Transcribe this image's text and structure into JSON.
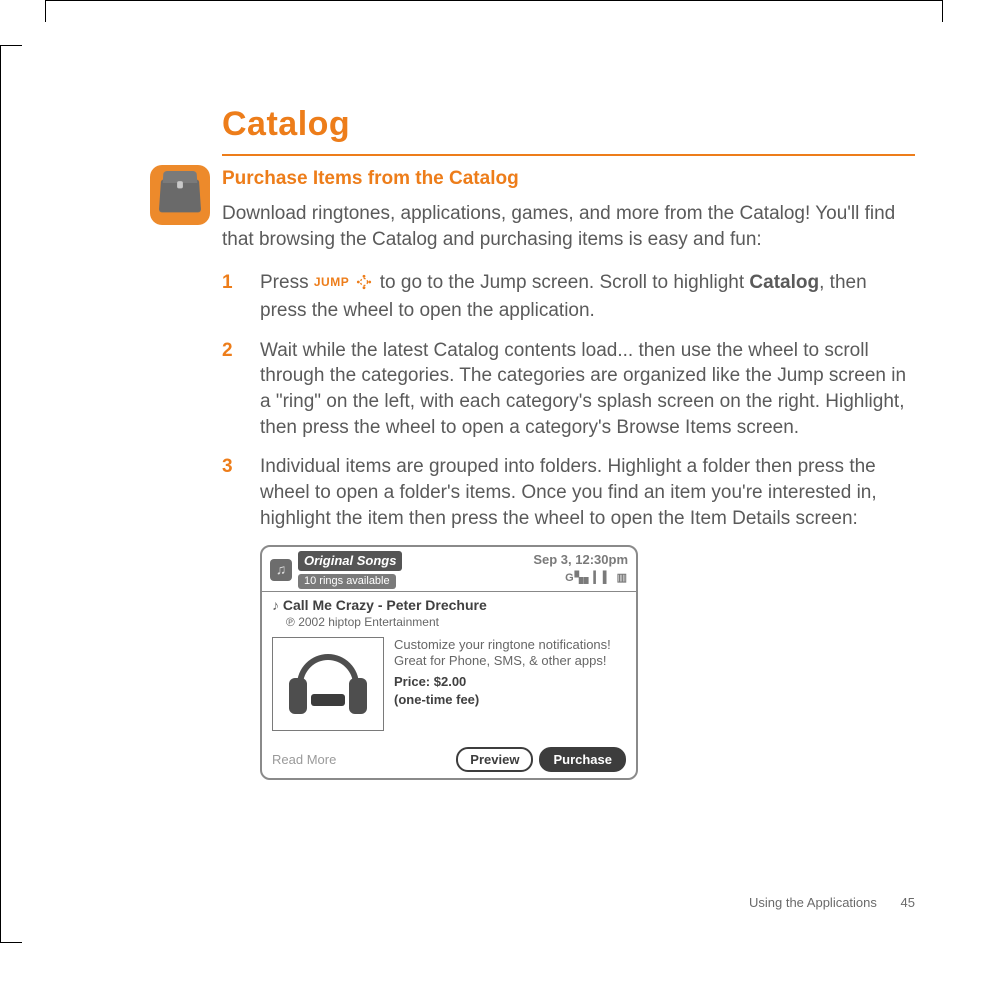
{
  "header": {
    "title": "Catalog"
  },
  "section": {
    "subhead": "Purchase Items from the Catalog",
    "intro": "Download ringtones, applications, games, and more from the Catalog! You'll find that browsing the Catalog and purchasing items is easy and fun:"
  },
  "jump": {
    "label": "JUMP"
  },
  "steps": {
    "s1": {
      "num": "1",
      "pre": "Press ",
      "post_a": "to go to the Jump screen. Scroll to highlight ",
      "bold": "Catalog",
      "post_b": ", then press the wheel to open the application."
    },
    "s2": {
      "num": "2",
      "text": "Wait while the latest Catalog contents load... then use the wheel to scroll through the categories. The categories are organized like the Jump screen in a \"ring\" on the left, with each category's splash screen on the right. Highlight, then press the wheel to open a category's Browse Items screen."
    },
    "s3": {
      "num": "3",
      "text": "Individual items are grouped into folders. Highlight a folder then press the wheel to open a folder's items. Once you find an item you're interested in, highlight the item then press the wheel to open the Item Details screen:"
    }
  },
  "device": {
    "titlebar": {
      "title": "Original Songs",
      "subtitle": "10 rings available",
      "datetime": "Sep 3, 12:30pm",
      "signal": "G▚▖▎▍ ▥"
    },
    "item": {
      "title": "Call Me Crazy - Peter Drechure",
      "copyright": "2002 hiptop Entertainment",
      "desc": "Customize your ringtone notifications! Great for Phone, SMS, & other apps!",
      "price_line1": "Price: $2.00",
      "price_line2": "(one-time fee)"
    },
    "footer": {
      "readmore": "Read More",
      "preview": "Preview",
      "purchase": "Purchase"
    }
  },
  "footer": {
    "section": "Using the Applications",
    "page": "45"
  }
}
